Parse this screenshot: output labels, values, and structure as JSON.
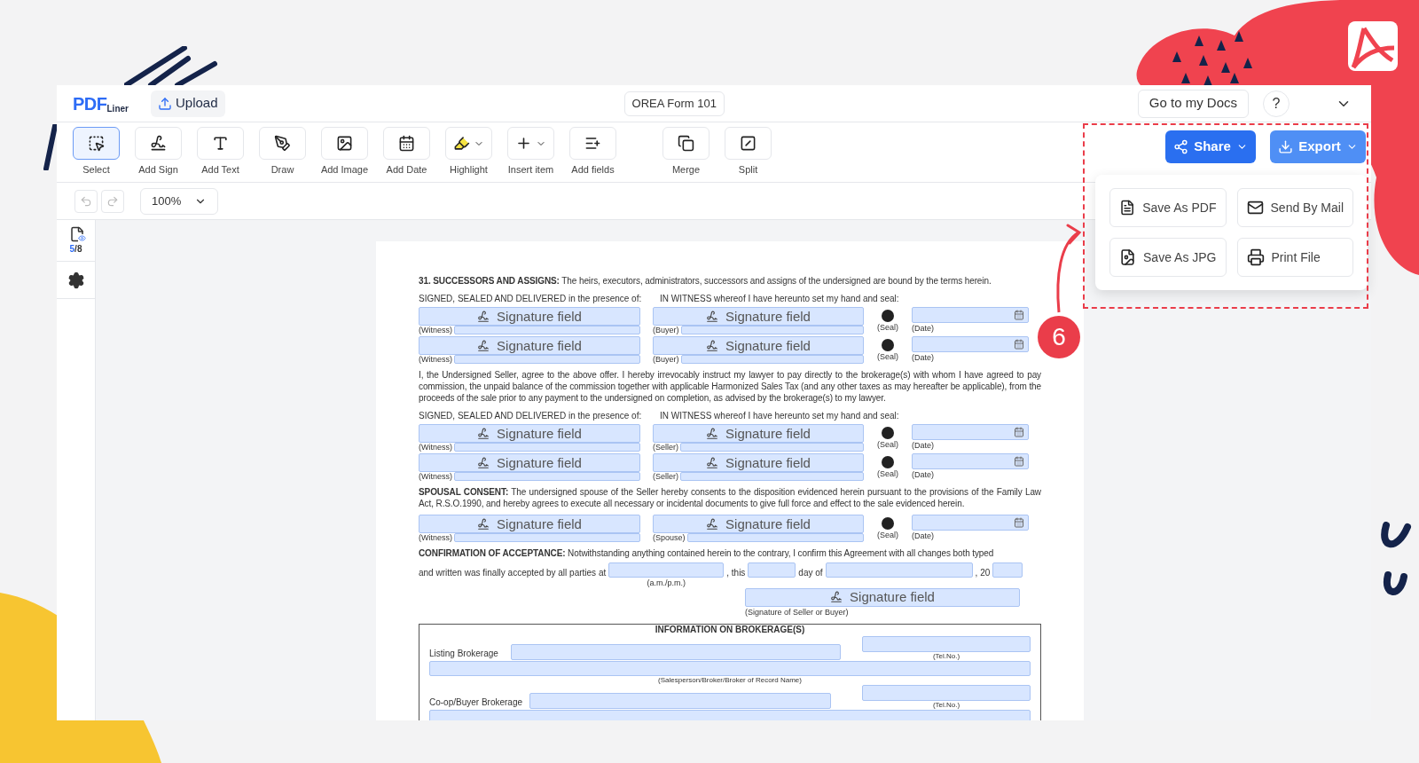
{
  "header": {
    "logo": {
      "mark": "PDF",
      "suffix": "Liner"
    },
    "upload": "Upload",
    "doc_title": "OREA Form 101",
    "go_to_docs": "Go to my Docs",
    "help": "?"
  },
  "toolbar": {
    "tools": [
      {
        "label": "Select",
        "selected": true,
        "dropdown": false
      },
      {
        "label": "Add Sign",
        "selected": false,
        "dropdown": false
      },
      {
        "label": "Add Text",
        "selected": false,
        "dropdown": false
      },
      {
        "label": "Draw",
        "selected": false,
        "dropdown": false
      },
      {
        "label": "Add Image",
        "selected": false,
        "dropdown": false
      },
      {
        "label": "Add Date",
        "selected": false,
        "dropdown": false
      },
      {
        "label": "Highlight",
        "selected": false,
        "dropdown": true
      },
      {
        "label": "Insert item",
        "selected": false,
        "dropdown": true
      },
      {
        "label": "Add fields",
        "selected": false,
        "dropdown": false
      }
    ],
    "page_tools": [
      {
        "label": "Merge"
      },
      {
        "label": "Split"
      }
    ],
    "share": "Share",
    "export": "Export"
  },
  "subbar": {
    "zoom": "100%"
  },
  "export_menu": [
    "Save As PDF",
    "Send By Mail",
    "Save As JPG",
    "Print File"
  ],
  "sidebar": {
    "current_page": "5",
    "page_total": "/8"
  },
  "document": [
    {
      "kind": "paragraph",
      "text": "**31. SUCCESSORS AND ASSIGNS:** The heirs, executors, administrators, successors and assigns of the undersigned are bound by the terms herein."
    },
    {
      "kind": "signatures",
      "left_heading": "SIGNED, SEALED AND DELIVERED in the presence of:",
      "right_heading": "IN WITNESS whereof I have hereunto set my hand and seal:",
      "rows": [
        {
          "left_field": "Signature field",
          "left_label": "(Witness)",
          "right_field": "Signature field",
          "right_label": "(Buyer)",
          "seal_label": "(Seal)",
          "date_label": "(Date)"
        },
        {
          "left_field": "Signature field",
          "left_label": "(Witness)",
          "right_field": "Signature field",
          "right_label": "(Buyer)",
          "seal_label": "(Seal)",
          "date_label": "(Date)"
        }
      ]
    },
    {
      "kind": "paragraph",
      "text": "I, the Undersigned Seller, agree to the above offer. I hereby irrevocably instruct my lawyer to pay directly to the brokerage(s) with whom I have agreed to pay commission, the unpaid balance of the commission together with applicable Harmonized Sales Tax (and any other taxes as may hereafter be applicable), from the proceeds of the sale prior to any payment to the undersigned on completion, as advised by the brokerage(s) to my lawyer."
    },
    {
      "kind": "signatures",
      "left_heading": "SIGNED, SEALED AND DELIVERED in the presence of:",
      "right_heading": "IN WITNESS whereof I have hereunto set my hand and seal:",
      "rows": [
        {
          "left_field": "Signature field",
          "left_label": "(Witness)",
          "right_field": "Signature field",
          "right_label": "(Seller)",
          "seal_label": "(Seal)",
          "date_label": "(Date)"
        },
        {
          "left_field": "Signature field",
          "left_label": "(Witness)",
          "right_field": "Signature field",
          "right_label": "(Seller)",
          "seal_label": "(Seal)",
          "date_label": "(Date)"
        }
      ]
    },
    {
      "kind": "paragraph",
      "text": "**SPOUSAL CONSENT:** The undersigned spouse of the Seller hereby consents to the disposition evidenced herein pursuant to the provisions of the Family Law Act, R.S.O.1990, and hereby agrees to execute all necessary or incidental documents to give full force and effect to the sale evidenced herein."
    },
    {
      "kind": "signatures",
      "rows": [
        {
          "left_field": "Signature field",
          "left_label": "(Witness)",
          "right_field": "Signature field",
          "right_label": "(Spouse)",
          "seal_label": "(Seal)",
          "date_label": "(Date)"
        }
      ]
    },
    {
      "kind": "paragraph",
      "text": "**CONFIRMATION OF ACCEPTANCE:** Notwithstanding anything contained herein to the contrary, I confirm this Agreement with all changes both typed"
    },
    {
      "kind": "acceptance",
      "lead": "and written was finally accepted by all parties at",
      "time_label": "(a.m./p.m.)",
      "this": ", this",
      "day_of": "day of",
      "year": ", 20",
      "signature": "Signature field",
      "signature_label": "(Signature of Seller or Buyer)"
    },
    {
      "kind": "brokerage",
      "title": "INFORMATION ON BROKERAGE(S)",
      "listing": "Listing Brokerage",
      "tel_1": "(Tel.No.)",
      "salesperson": "(Salesperson/Broker/Broker of Record Name)",
      "coop": "Co-op/Buyer Brokerage",
      "tel_2": "(Tel.No.)"
    }
  ],
  "annotation": {
    "step": "6"
  }
}
